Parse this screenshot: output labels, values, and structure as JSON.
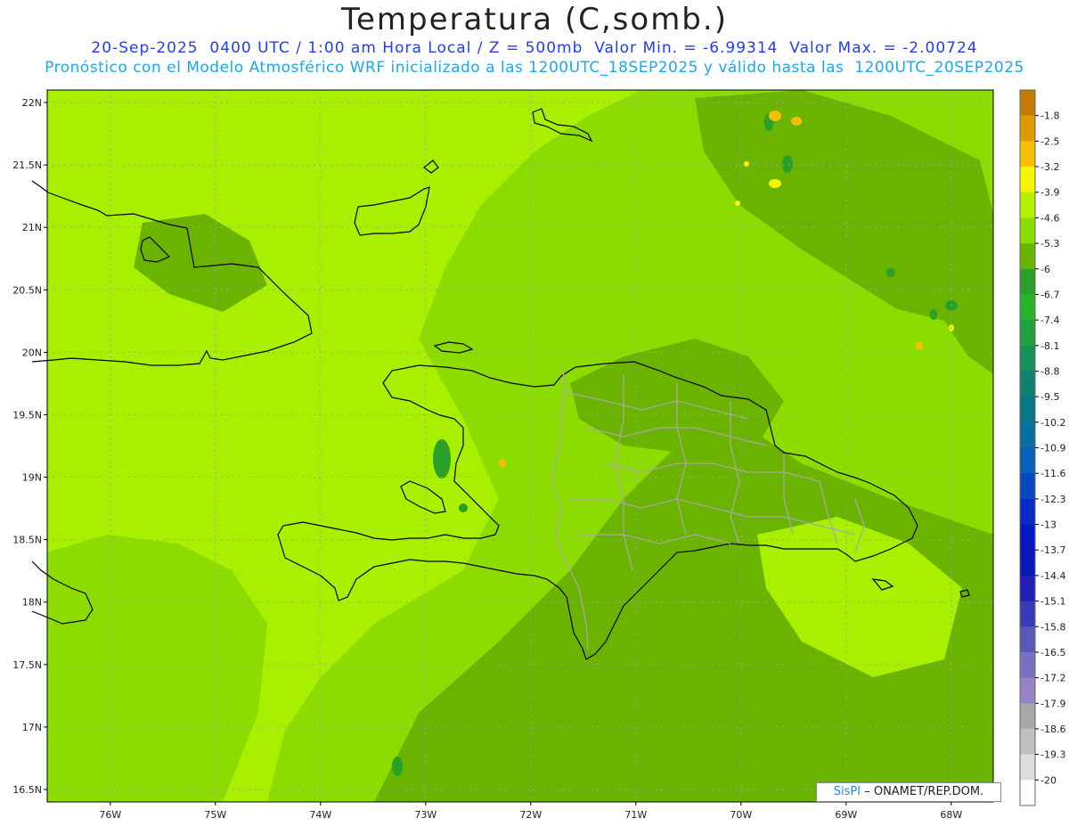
{
  "header": {
    "title": "Temperatura (C,somb.)",
    "line1": "20-Sep-2025  0400 UTC / 1:00 am Hora Local / Z = 500mb  Valor Min. = -6.99314  Valor Max. = -2.00724",
    "line2": "Pronóstico con el Modelo Atmosférico WRF inicializado a las 1200UTC_18SEP2025 y válido hasta las  1200UTC_20SEP2025"
  },
  "axes": {
    "lat_labels": [
      "22N",
      "21.5N",
      "21N",
      "20.5N",
      "20N",
      "19.5N",
      "19N",
      "18.5N",
      "18N",
      "17.5N",
      "17N",
      "16.5N"
    ],
    "lat_values": [
      22,
      21.5,
      21,
      20.5,
      20,
      19.5,
      19,
      18.5,
      18,
      17.5,
      17,
      16.5
    ],
    "lon_labels": [
      "76W",
      "75W",
      "74W",
      "73W",
      "72W",
      "71W",
      "70W",
      "69W",
      "68W"
    ],
    "lon_values": [
      -76,
      -75,
      -74,
      -73,
      -72,
      -71,
      -70,
      -69,
      -68
    ],
    "lat_range": [
      16.4,
      22.1
    ],
    "lon_range": [
      -76.6,
      -67.6
    ]
  },
  "colorbar": {
    "labels": [
      "-1.8",
      "-2.5",
      "-3.2",
      "-3.9",
      "-4.6",
      "-5.3",
      "-6",
      "-6.7",
      "-7.4",
      "-8.1",
      "-8.8",
      "-9.5",
      "-10.2",
      "-10.9",
      "-11.6",
      "-12.3",
      "-13",
      "-13.7",
      "-14.4",
      "-15.1",
      "-15.8",
      "-16.5",
      "-17.2",
      "-17.9",
      "-18.6",
      "-19.3",
      "-20"
    ],
    "colors": [
      "#c47a00",
      "#e09a00",
      "#f5c000",
      "#f5f500",
      "#b4f000",
      "#8cdc00",
      "#6ab400",
      "#2aa02a",
      "#28b428",
      "#20a040",
      "#18905a",
      "#108070",
      "#087888",
      "#0870a0",
      "#0860b8",
      "#0848c0",
      "#0828c8",
      "#0818c0",
      "#0818b8",
      "#2020b8",
      "#3a3ab8",
      "#5858b8",
      "#7a70c0",
      "#9484c4",
      "#a8a8a8",
      "#c0c0c0",
      "#dcdcdc",
      "#ffffff"
    ]
  },
  "field_colors": {
    "base": "#a8f000",
    "mid": "#8cdc00",
    "dark": "#6ab400",
    "green": "#2aa02a",
    "yellow": "#f5f500",
    "orange": "#f5c000"
  },
  "credit": {
    "brand": "SisPI",
    "text": "– ONAMET/REP.DOM."
  }
}
